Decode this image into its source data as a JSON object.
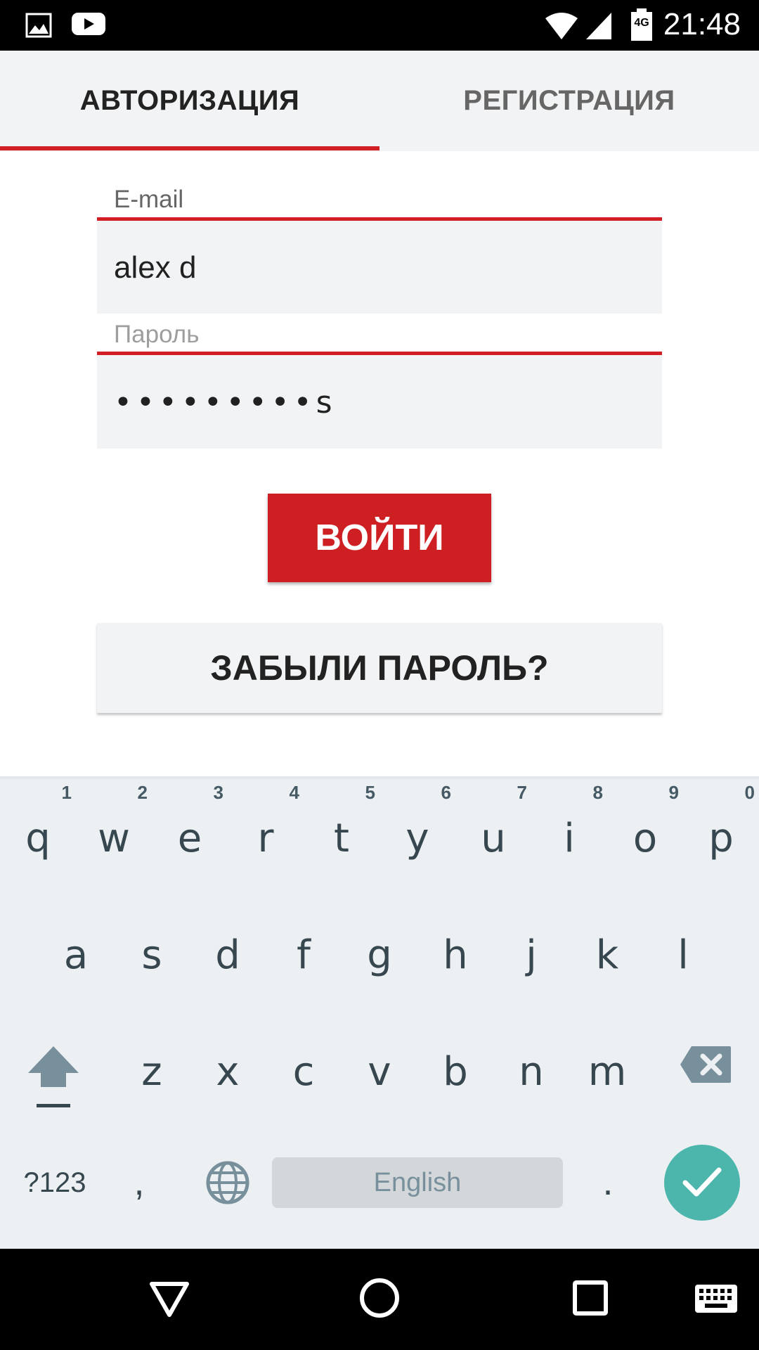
{
  "status_bar": {
    "time": "21:48",
    "network_label": "4G",
    "icons": [
      "image-icon",
      "youtube-icon",
      "wifi-icon",
      "signal-icon",
      "battery-icon"
    ]
  },
  "tabs": {
    "auth_label": "АВТОРИЗАЦИЯ",
    "reg_label": "РЕГИСТРАЦИЯ",
    "active": "АВТОРИЗАЦИЯ"
  },
  "form": {
    "email_label": "E-mail",
    "email_value": "alex d",
    "password_label": "Пароль",
    "password_value": "•••••••••s",
    "login_label": "ВОЙТИ",
    "forgot_label": "ЗАБЫЛИ ПАРОЛЬ?"
  },
  "keyboard": {
    "row1": [
      {
        "key": "q",
        "hint": "1"
      },
      {
        "key": "w",
        "hint": "2"
      },
      {
        "key": "e",
        "hint": "3"
      },
      {
        "key": "r",
        "hint": "4"
      },
      {
        "key": "t",
        "hint": "5"
      },
      {
        "key": "y",
        "hint": "6"
      },
      {
        "key": "u",
        "hint": "7"
      },
      {
        "key": "i",
        "hint": "8"
      },
      {
        "key": "o",
        "hint": "9"
      },
      {
        "key": "p",
        "hint": "0"
      }
    ],
    "row2": [
      "a",
      "s",
      "d",
      "f",
      "g",
      "h",
      "j",
      "k",
      "l"
    ],
    "row3": [
      "z",
      "x",
      "c",
      "v",
      "b",
      "n",
      "m"
    ],
    "symbols_label": "?123",
    "comma": ",",
    "space_label": "English",
    "period": "."
  },
  "colors": {
    "accent": "#d21f25",
    "enter_key": "#4db6ac"
  }
}
